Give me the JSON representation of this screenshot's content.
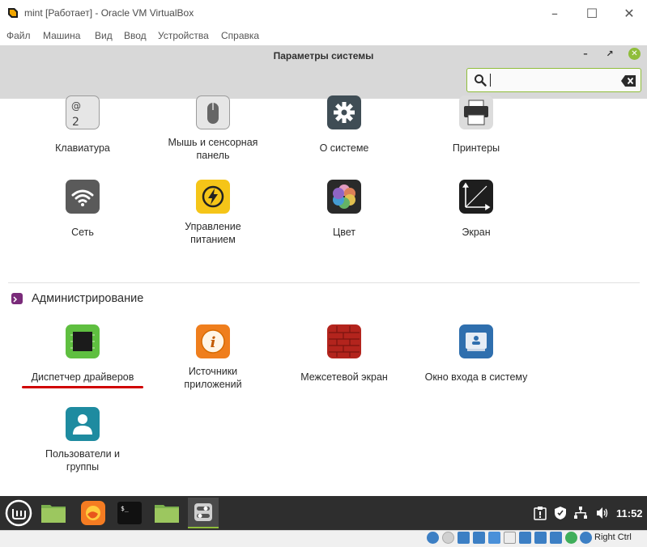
{
  "vbox": {
    "title": "mint [Работает] - Oracle VM VirtualBox",
    "menu": [
      "Файл",
      "Машина",
      "Вид",
      "Ввод",
      "Устройства",
      "Справка"
    ],
    "host_key": "Right Ctrl"
  },
  "settings": {
    "title": "Параметры системы",
    "search": {
      "value": "",
      "placeholder": ""
    }
  },
  "hardware_items": [
    {
      "label": "Клавиатура",
      "icon": "keyboard-icon"
    },
    {
      "label": "Мышь и сенсорная панель",
      "icon": "mouse-icon"
    },
    {
      "label": "О системе",
      "icon": "gear-icon"
    },
    {
      "label": "Принтеры",
      "icon": "printer-icon"
    },
    {
      "label": "Сеть",
      "icon": "wifi-icon"
    },
    {
      "label": "Управление питанием",
      "icon": "power-icon"
    },
    {
      "label": "Цвет",
      "icon": "color-icon"
    },
    {
      "label": "Экран",
      "icon": "display-icon"
    }
  ],
  "admin_section": {
    "title": "Администрирование",
    "items": [
      {
        "label": "Диспетчер драйверов",
        "icon": "chip-icon"
      },
      {
        "label": "Источники приложений",
        "icon": "info-icon"
      },
      {
        "label": "Межсетевой экран",
        "icon": "firewall-icon"
      },
      {
        "label": "Окно входа в систему",
        "icon": "login-window-icon"
      },
      {
        "label": "Пользователи и группы",
        "icon": "users-icon"
      }
    ]
  },
  "panel": {
    "clock": "11:52"
  },
  "colors": {
    "accent_green": "#8fbd3a",
    "panel_bg": "#2e2e2e",
    "underline_red": "#d00000",
    "admin_purple": "#7a2b7a"
  }
}
